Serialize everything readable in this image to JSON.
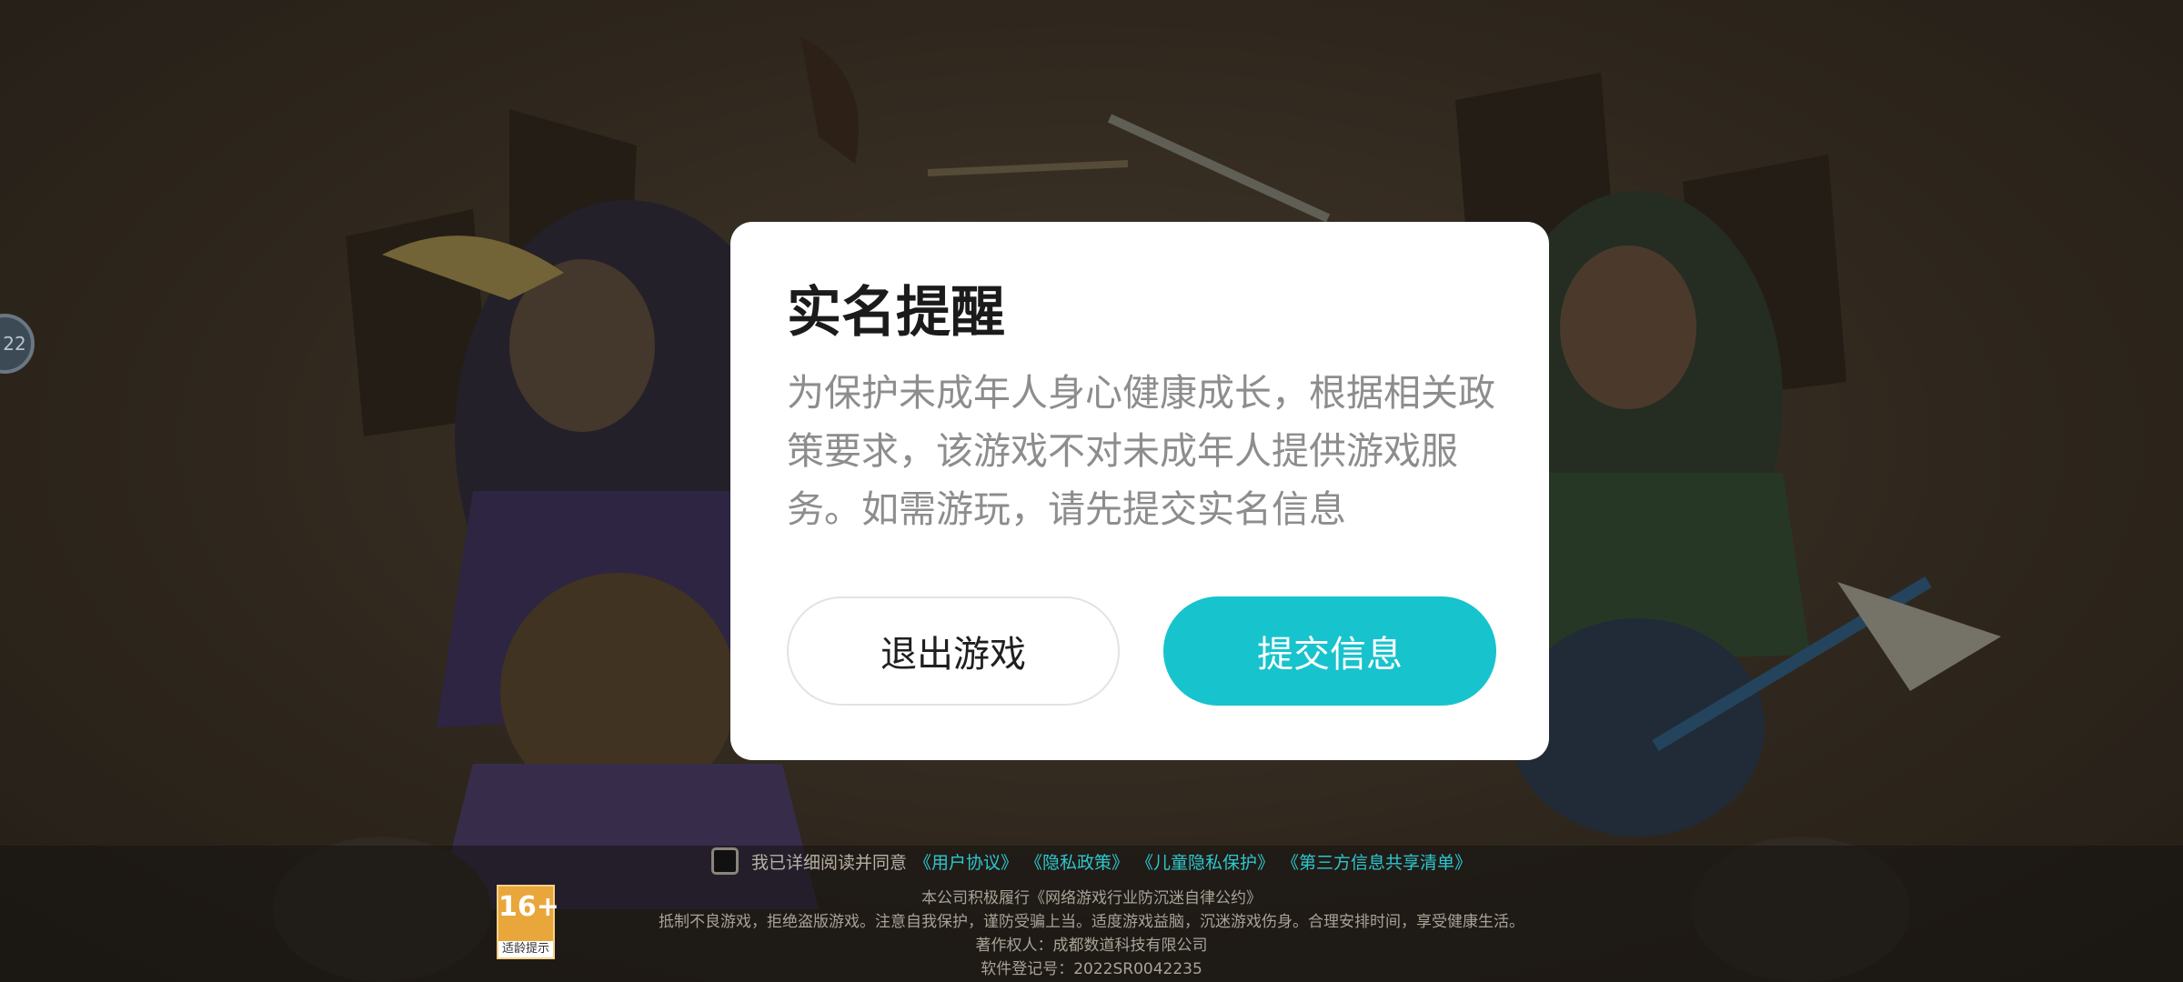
{
  "colors": {
    "accent": "#17c3cc",
    "link": "#2cc7cf",
    "age_badge": "#e9a63a"
  },
  "side_badge": {
    "label": "22"
  },
  "dialog": {
    "title": "实名提醒",
    "body": "为保护未成年人身心健康成长，根据相关政策要求，该游戏不对未成年人提供游戏服务。如需游玩，请先提交实名信息",
    "exit_button": "退出游戏",
    "submit_button": "提交信息"
  },
  "footer": {
    "agree_prefix": "我已详细阅读并同意",
    "links": [
      "《用户协议》",
      "《隐私政策》",
      "《儿童隐私保护》",
      "《第三方信息共享清单》"
    ],
    "line1": "本公司积极履行《网络游戏行业防沉迷自律公约》",
    "line2": "抵制不良游戏，拒绝盗版游戏。注意自我保护，谨防受骗上当。适度游戏益脑，沉迷游戏伤身。合理安排时间，享受健康生活。",
    "line3": "著作权人：成都数道科技有限公司",
    "line4": "软件登记号：2022SR0042235",
    "age_rating": "16+",
    "age_caption": "适龄提示"
  }
}
